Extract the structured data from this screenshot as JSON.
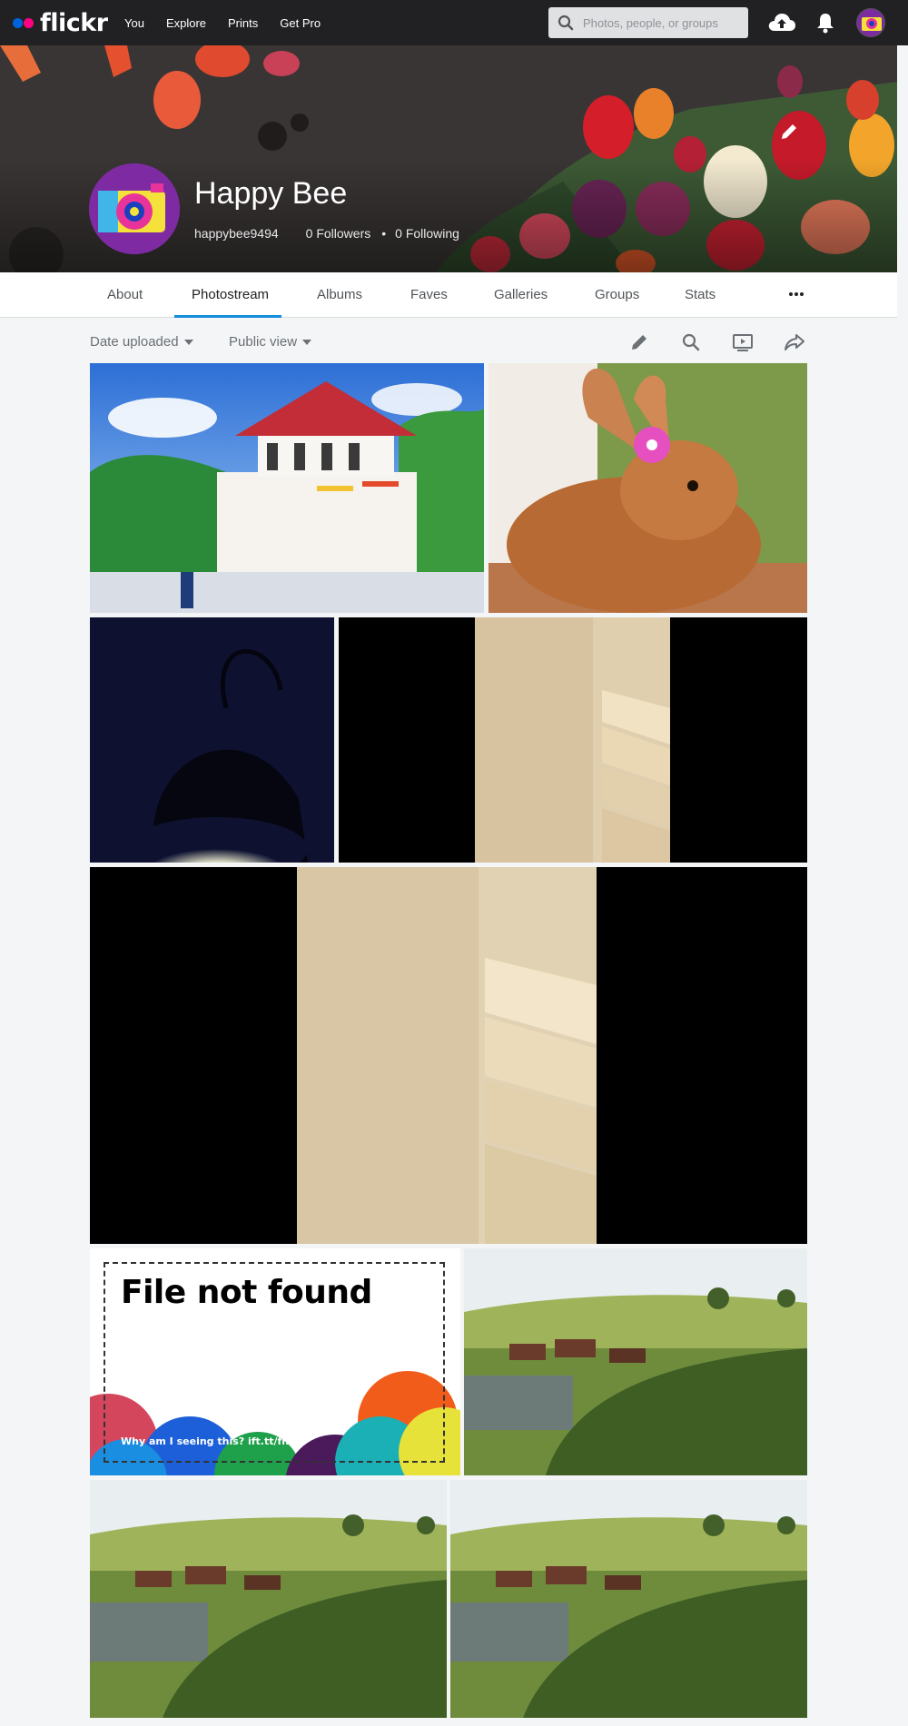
{
  "nav": {
    "brand": "flickr",
    "links": [
      "You",
      "Explore",
      "Prints",
      "Get Pro"
    ],
    "search_placeholder": "Photos, people, or groups",
    "brand_colors": {
      "blue": "#0063dc",
      "pink": "#ff0084"
    }
  },
  "profile": {
    "name": "Happy Bee",
    "username": "happybee9494",
    "followers": "0 Followers",
    "following": "0 Following"
  },
  "tabs": [
    "About",
    "Photostream",
    "Albums",
    "Faves",
    "Galleries",
    "Groups",
    "Stats"
  ],
  "active_tab": "Photostream",
  "toolbar": {
    "sort_label": "Date uploaded",
    "view_label": "Public view"
  },
  "photos": [
    {
      "desc": "Temple of the Tooth, Kandy"
    },
    {
      "desc": "Rabbit with pink flower"
    },
    {
      "desc": "Desk lamp in dark"
    },
    {
      "desc": "Cabinet shelves"
    },
    {
      "desc": "Cabinet shelves close-up"
    },
    {
      "desc": "File not found"
    },
    {
      "desc": "Hobbiton village"
    },
    {
      "desc": "Hobbiton village"
    },
    {
      "desc": "Hobbiton village"
    }
  ],
  "file_not_found": {
    "title": "File not found",
    "subtitle": "Why am I seeing this? ift.tt/fnf"
  },
  "accent_color": "#128fdc"
}
